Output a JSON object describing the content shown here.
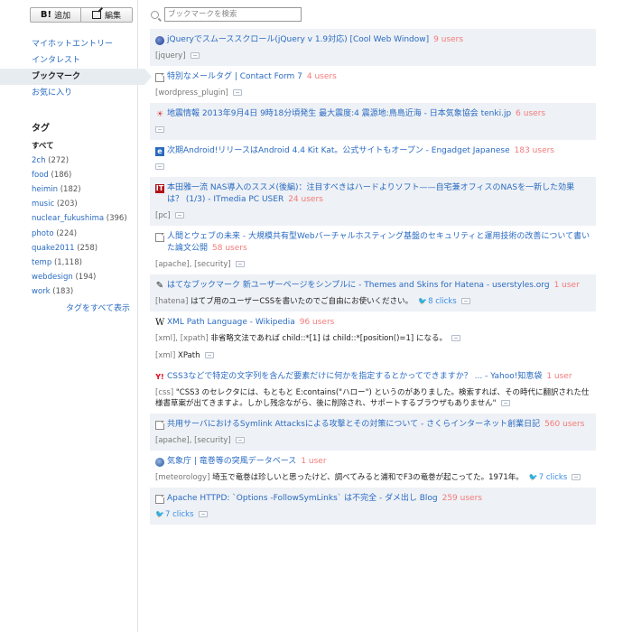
{
  "sidebar": {
    "add_label": "追加",
    "edit_label": "編集",
    "nav": [
      {
        "label": "マイホットエントリー",
        "active": false
      },
      {
        "label": "インタレスト",
        "active": false
      },
      {
        "label": "ブックマーク",
        "active": true
      },
      {
        "label": "お気に入り",
        "active": false
      }
    ],
    "tags_heading": "タグ",
    "all_label": "すべて",
    "tags": [
      {
        "name": "2ch",
        "count": "(272)"
      },
      {
        "name": "food",
        "count": "(186)"
      },
      {
        "name": "heimin",
        "count": "(182)"
      },
      {
        "name": "music",
        "count": "(203)"
      },
      {
        "name": "nuclear_fukushima",
        "count": "(396)"
      },
      {
        "name": "photo",
        "count": "(224)"
      },
      {
        "name": "quake2011",
        "count": "(258)"
      },
      {
        "name": "temp",
        "count": "(1,118)"
      },
      {
        "name": "webdesign",
        "count": "(194)"
      },
      {
        "name": "work",
        "count": "(183)"
      }
    ],
    "show_all_tags": "タグをすべて表示"
  },
  "search": {
    "placeholder": "ブックマークを検索"
  },
  "entries": [
    {
      "icon": "jquery-favicon",
      "title": "jQueryでスムーススクロール(jQuery v 1.9対応) [Cool Web Window]",
      "users": "9 users",
      "tags": "[jquery]",
      "comment": ""
    },
    {
      "icon": "document-icon",
      "title": "特別なメールタグ | Contact Form 7",
      "users": "4 users",
      "tags": "[wordpress_plugin]",
      "comment": ""
    },
    {
      "icon": "tenki-favicon",
      "title": "地震情報 2013年9月4日 9時18分頃発生 最大震度:4 震源地:鳥島近海 - 日本気象協会 tenki.jp",
      "users": "6 users",
      "tags": "",
      "comment": ""
    },
    {
      "icon": "engadget-favicon",
      "title": "次期Android!リリースはAndroid 4.4 Kit Kat。公式サイトもオープン - Engadget Japanese",
      "users": "183 users",
      "tags": "",
      "comment": ""
    },
    {
      "icon": "itmedia-favicon",
      "title": "本田雅一流 NAS導入のススメ(後編)：注目すべきはハードよりソフト——自宅兼オフィスのNASを一新した効果は？ (1/3) - ITmedia PC USER",
      "users": "24 users",
      "tags": "[pc]",
      "comment": ""
    },
    {
      "icon": "document-icon",
      "title": "人間とウェブの未来 - 大規模共有型Webバーチャルホスティング基盤のセキュリティと運用技術の改善について書いた論文公開",
      "users": "58 users",
      "tags": "[apache], [security]",
      "comment": ""
    },
    {
      "icon": "hatena-favicon",
      "title": "はてなブックマーク 新ユーザーページをシンプルに - Themes and Skins for Hatena - userstyles.org",
      "users": "1 user",
      "tags": "[hatena]",
      "comment": "はてブ用のユーザーCSSを書いたのでご自由にお使いください。",
      "clicks": "8 clicks"
    },
    {
      "icon": "wikipedia-favicon",
      "title": "XML Path Language - Wikipedia",
      "users": "96 users",
      "tags": "[xml], [xpath]",
      "comment": "非省略文法であれば child::*[1] は child::*[position()=1] になる。",
      "tags2": "[xml]",
      "comment2": "XPath"
    },
    {
      "icon": "yahoo-favicon",
      "title": "CSS3などで特定の文字列を含んだ要素だけに何かを指定するとかってできますか？ ... - Yahoo!知恵袋",
      "users": "1 user",
      "tags": "[css]",
      "comment": "\"CSS3 のセレクタには、もともと E:contains(\"ハロー\") というのがありました。検索すれば、その時代に翻訳された仕様書草案が出てきますよ。しかし残念ながら、後に削除され、サポートするブラウザもありません\""
    },
    {
      "icon": "document-icon",
      "title": "共用サーバにおけるSymlink Attacksによる攻撃とその対策について - さくらインターネット創業日記",
      "users": "560 users",
      "tags": "[apache], [security]",
      "comment": ""
    },
    {
      "icon": "jma-favicon",
      "title": "気象庁 | 竜巻等の突風データベース",
      "users": "1 user",
      "tags": "[meteorology]",
      "comment": "埼玉で竜巻は珍しいと思ったけど、調べてみると浦和でF3の竜巻が起こってた。1971年。",
      "clicks": "7 clicks"
    },
    {
      "icon": "document-icon",
      "title": "Apache HTTPD: `Options -FollowSymLinks` は不完全 - ダメ出し Blog",
      "users": "259 users",
      "tags": "",
      "comment": "",
      "clicks": "7 clicks"
    }
  ]
}
